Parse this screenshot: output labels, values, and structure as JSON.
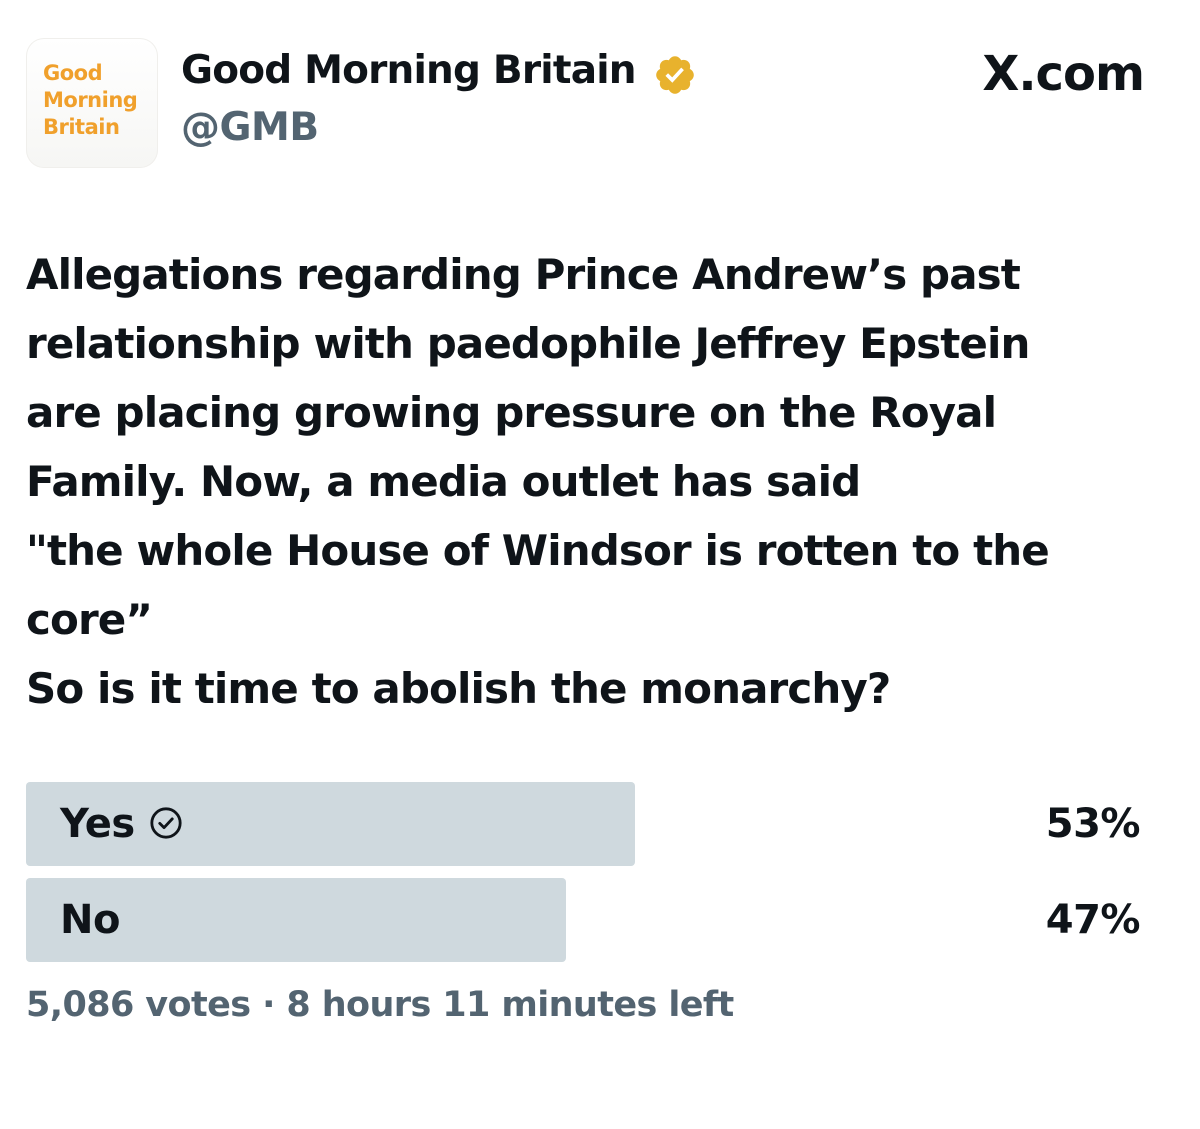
{
  "account": {
    "avatar_lines": [
      "Good",
      "Morning",
      "Britain"
    ],
    "display_name": "Good Morning Britain",
    "handle": "@GMB",
    "verified_color": "#e8b22d",
    "avatar_text_color": "#f0a02c"
  },
  "brand": {
    "site": "X.com"
  },
  "tweet": {
    "lines": [
      "Allegations regarding Prince Andrew’s past",
      "relationship with paedophile Jeffrey Epstein",
      "are placing growing pressure on the Royal",
      "Family. Now, a media outlet has said",
      "\"the whole House of Windsor is rotten to the",
      "core”",
      "So is it time to abolish the monarchy?"
    ]
  },
  "poll": {
    "options": [
      {
        "label": "Yes",
        "percent_text": "53%",
        "percent": 53,
        "selected": true,
        "icon": "check-circle-icon"
      },
      {
        "label": "No",
        "percent_text": "47%",
        "percent": 47,
        "selected": false
      }
    ],
    "votes": "5,086 votes",
    "separator": "·",
    "time_left": "8 hours 11 minutes left",
    "bar_color": "#cfd9de"
  }
}
